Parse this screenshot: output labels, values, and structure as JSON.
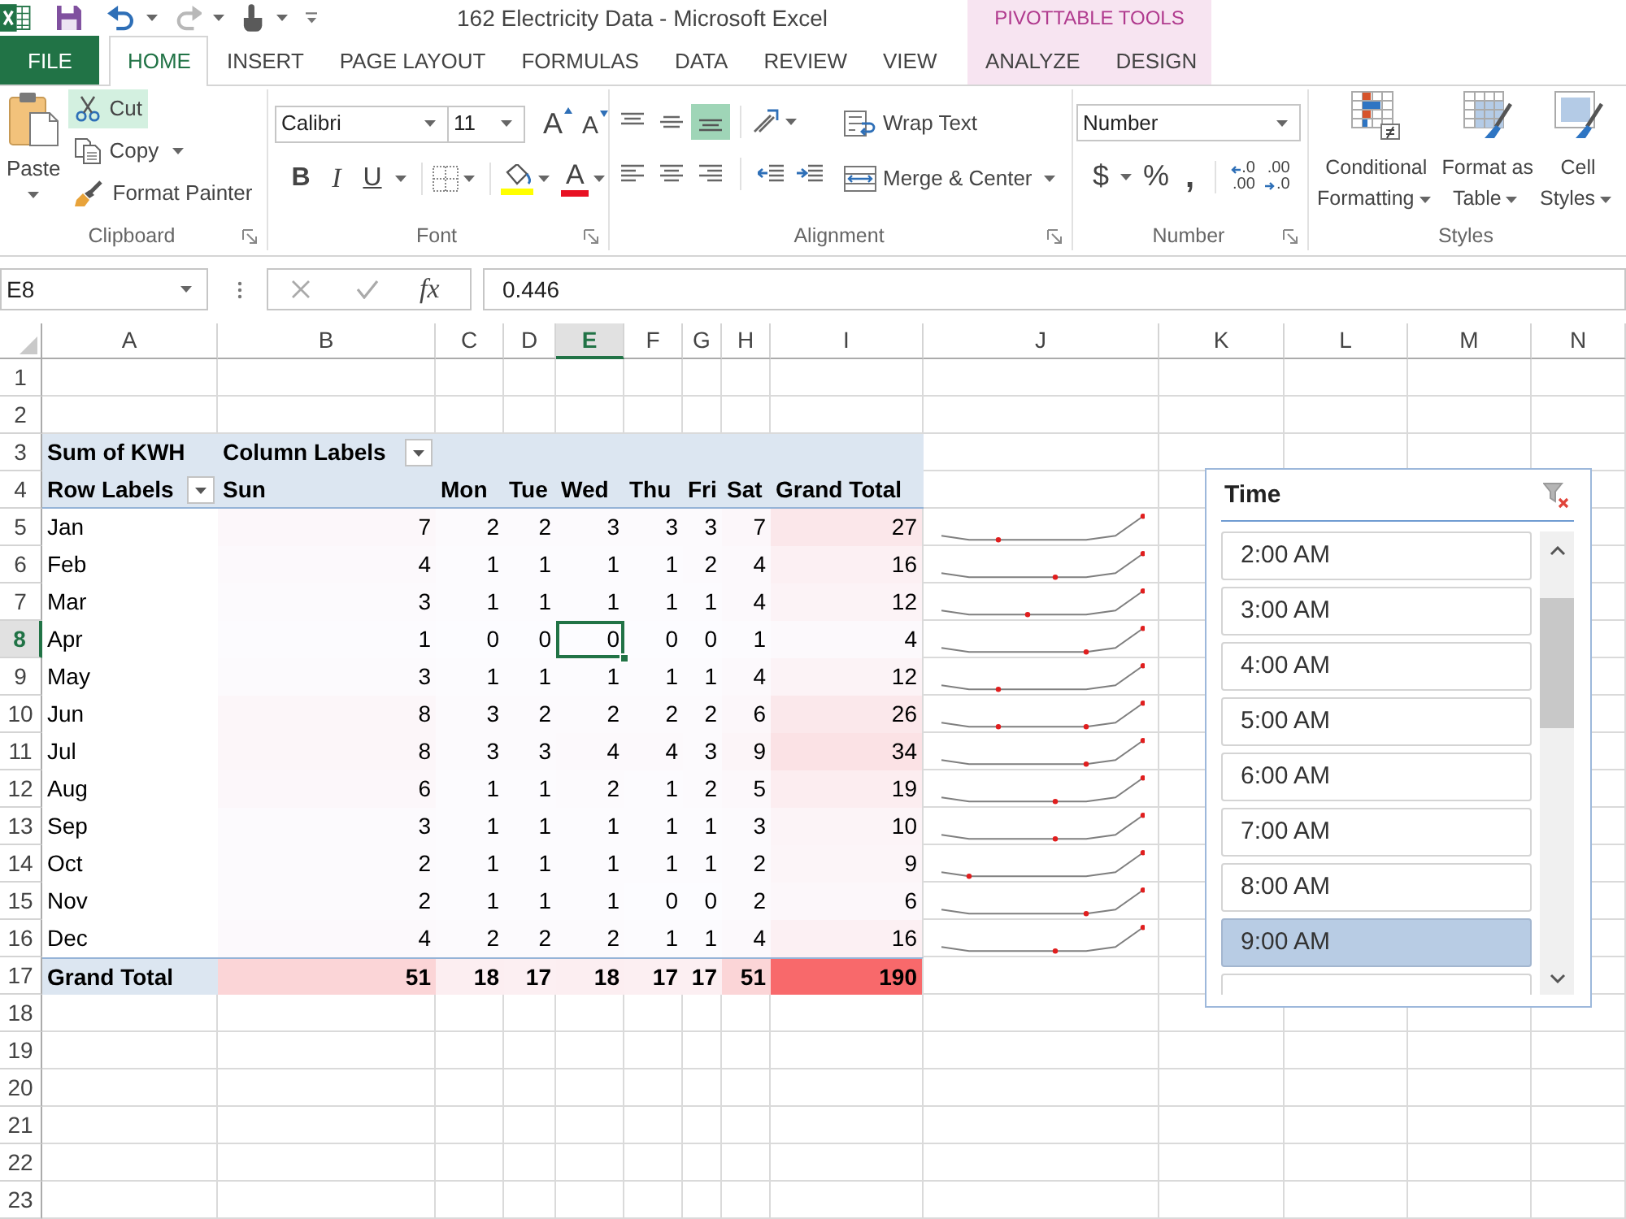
{
  "title_bar": {
    "title": "162 Electricity Data - Microsoft Excel",
    "context_label": "PIVOTTABLE TOOLS"
  },
  "tabs": [
    {
      "label": "FILE",
      "kind": "file",
      "selected": false
    },
    {
      "label": "HOME",
      "kind": "standard",
      "selected": true
    },
    {
      "label": "INSERT",
      "kind": "standard",
      "selected": false
    },
    {
      "label": "PAGE LAYOUT",
      "kind": "standard",
      "selected": false
    },
    {
      "label": "FORMULAS",
      "kind": "standard",
      "selected": false
    },
    {
      "label": "DATA",
      "kind": "standard",
      "selected": false
    },
    {
      "label": "REVIEW",
      "kind": "standard",
      "selected": false
    },
    {
      "label": "VIEW",
      "kind": "standard",
      "selected": false
    },
    {
      "label": "ANALYZE",
      "kind": "contextual",
      "selected": false
    },
    {
      "label": "DESIGN",
      "kind": "contextual",
      "selected": false
    }
  ],
  "ribbon": {
    "clipboard": {
      "label": "Clipboard",
      "paste": "Paste",
      "commands": [
        {
          "kind": "cut",
          "label": "Cut",
          "highlighted": true
        },
        {
          "kind": "copy",
          "label": "Copy",
          "highlighted": false
        },
        {
          "kind": "format_painter",
          "label": "Format Painter",
          "highlighted": false
        }
      ]
    },
    "font": {
      "label": "Font",
      "font_name": "Calibri",
      "font_size": "11",
      "grow": "A",
      "shrink": "A",
      "bold": "B",
      "italic": "I",
      "underline": "U",
      "font_color": "A"
    },
    "alignment": {
      "label": "Alignment",
      "vertical": [
        {
          "kind": "top",
          "selected": false
        },
        {
          "kind": "middle",
          "selected": false
        },
        {
          "kind": "bottom",
          "selected": true
        }
      ],
      "wrap_text": "Wrap Text",
      "merge_center": "Merge & Center"
    },
    "number": {
      "label": "Number",
      "format": "Number",
      "currency": "$",
      "percent": "%",
      "comma": ",",
      "decimals": [
        {
          "kind": "increase",
          "lines": [
            ".0",
            ".00"
          ]
        },
        {
          "kind": "decrease",
          "lines": [
            ".00",
            ".0"
          ]
        }
      ]
    },
    "styles": {
      "label": "Styles",
      "buttons": [
        {
          "kind": "conditional",
          "lines": [
            "Conditional",
            "Formatting"
          ]
        },
        {
          "kind": "table",
          "lines": [
            "Format as",
            "Table"
          ]
        },
        {
          "kind": "cell",
          "lines": [
            "Cell",
            "Styles"
          ]
        }
      ]
    }
  },
  "formula_bar": {
    "name_box": "E8",
    "function_label": "fx",
    "formula": "0.446"
  },
  "sheet": {
    "columns": [
      {
        "label": "A",
        "selected": false
      },
      {
        "label": "B",
        "selected": false
      },
      {
        "label": "C",
        "selected": false
      },
      {
        "label": "D",
        "selected": false
      },
      {
        "label": "E",
        "selected": true
      },
      {
        "label": "F",
        "selected": false
      },
      {
        "label": "G",
        "selected": false
      },
      {
        "label": "H",
        "selected": false
      },
      {
        "label": "I",
        "selected": false
      },
      {
        "label": "J",
        "selected": false
      },
      {
        "label": "K",
        "selected": false
      },
      {
        "label": "L",
        "selected": false
      },
      {
        "label": "M",
        "selected": false
      },
      {
        "label": "N",
        "selected": false
      }
    ],
    "row_numbers": [
      {
        "label": "1",
        "selected": false
      },
      {
        "label": "2",
        "selected": false
      },
      {
        "label": "3",
        "selected": false
      },
      {
        "label": "4",
        "selected": false
      },
      {
        "label": "5",
        "selected": false
      },
      {
        "label": "6",
        "selected": false
      },
      {
        "label": "7",
        "selected": false
      },
      {
        "label": "8",
        "selected": true
      },
      {
        "label": "9",
        "selected": false
      },
      {
        "label": "10",
        "selected": false
      },
      {
        "label": "11",
        "selected": false
      },
      {
        "label": "12",
        "selected": false
      },
      {
        "label": "13",
        "selected": false
      },
      {
        "label": "14",
        "selected": false
      },
      {
        "label": "15",
        "selected": false
      },
      {
        "label": "16",
        "selected": false
      },
      {
        "label": "17",
        "selected": false
      },
      {
        "label": "18",
        "selected": false
      },
      {
        "label": "19",
        "selected": false
      },
      {
        "label": "20",
        "selected": false
      },
      {
        "label": "21",
        "selected": false
      },
      {
        "label": "22",
        "selected": false
      },
      {
        "label": "23",
        "selected": false
      }
    ],
    "pivot": {
      "value_field": "Sum of KWH",
      "column_labels": "Column Labels",
      "row_labels": "Row Labels",
      "headers": [
        "Sun",
        "Mon",
        "Tue",
        "Wed",
        "Thu",
        "Fri",
        "Sat",
        "Grand Total"
      ],
      "rows": [
        {
          "label": "Jan",
          "values": [
            "7",
            "2",
            "2",
            "3",
            "3",
            "3",
            "7",
            "27"
          ]
        },
        {
          "label": "Feb",
          "values": [
            "4",
            "1",
            "1",
            "1",
            "1",
            "2",
            "4",
            "16"
          ]
        },
        {
          "label": "Mar",
          "values": [
            "3",
            "1",
            "1",
            "1",
            "1",
            "1",
            "4",
            "12"
          ]
        },
        {
          "label": "Apr",
          "values": [
            "1",
            "0",
            "0",
            "0",
            "0",
            "0",
            "1",
            "4"
          ]
        },
        {
          "label": "May",
          "values": [
            "3",
            "1",
            "1",
            "1",
            "1",
            "1",
            "4",
            "12"
          ]
        },
        {
          "label": "Jun",
          "values": [
            "8",
            "3",
            "2",
            "2",
            "2",
            "2",
            "6",
            "26"
          ]
        },
        {
          "label": "Jul",
          "values": [
            "8",
            "3",
            "3",
            "4",
            "4",
            "3",
            "9",
            "34"
          ]
        },
        {
          "label": "Aug",
          "values": [
            "6",
            "1",
            "1",
            "2",
            "1",
            "2",
            "5",
            "19"
          ]
        },
        {
          "label": "Sep",
          "values": [
            "3",
            "1",
            "1",
            "1",
            "1",
            "1",
            "3",
            "10"
          ]
        },
        {
          "label": "Oct",
          "values": [
            "2",
            "1",
            "1",
            "1",
            "1",
            "1",
            "2",
            "9"
          ]
        },
        {
          "label": "Nov",
          "values": [
            "2",
            "1",
            "1",
            "1",
            "0",
            "0",
            "2",
            "6"
          ]
        },
        {
          "label": "Dec",
          "values": [
            "4",
            "2",
            "2",
            "2",
            "1",
            "1",
            "4",
            "16"
          ]
        }
      ],
      "total": {
        "label": "Grand Total",
        "values": [
          "51",
          "18",
          "17",
          "18",
          "17",
          "17",
          "51",
          "190"
        ]
      }
    },
    "slicer": {
      "title": "Time",
      "items": [
        {
          "label": "2:00 AM",
          "selected": false
        },
        {
          "label": "3:00 AM",
          "selected": false
        },
        {
          "label": "4:00 AM",
          "selected": false
        },
        {
          "label": "5:00 AM",
          "selected": false
        },
        {
          "label": "6:00 AM",
          "selected": false
        },
        {
          "label": "7:00 AM",
          "selected": false
        },
        {
          "label": "8:00 AM",
          "selected": false
        },
        {
          "label": "9:00 AM",
          "selected": true
        }
      ]
    }
  }
}
